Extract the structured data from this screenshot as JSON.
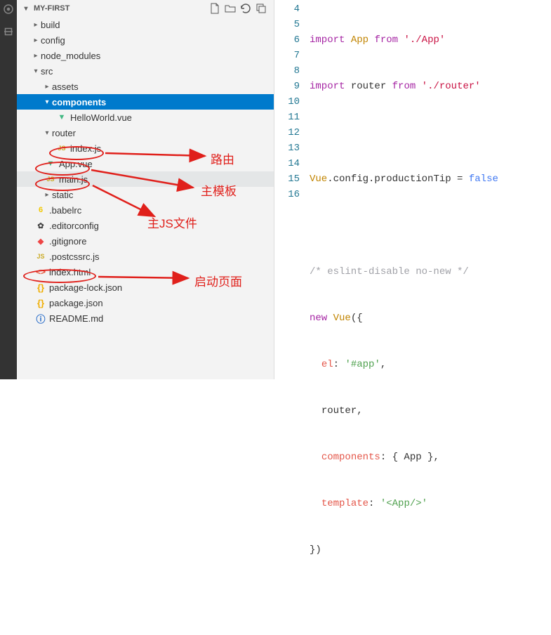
{
  "sidebar": {
    "project_label": "MY-FIRST",
    "items": {
      "build": "build",
      "config": "config",
      "node_modules": "node_modules",
      "src": "src",
      "assets": "assets",
      "components": "components",
      "helloworld": "HelloWorld.vue",
      "router": "router",
      "index_js": "index.js",
      "app_vue": "App.vue",
      "main_js": "main.js",
      "static": "static",
      "babelrc": ".babelrc",
      "editorconfig": ".editorconfig",
      "gitignore": ".gitignore",
      "postcssrc": ".postcssrc.js",
      "index_html": "index.html",
      "package_lock": "package-lock.json",
      "package": "package.json",
      "readme": "README.md"
    }
  },
  "code": {
    "l4_import": "import",
    "l4_app": "App",
    "l4_from": "from",
    "l4_path": "'./App'",
    "l5_import": "import",
    "l5_router": "router",
    "l5_from": "from",
    "l5_path": "'./router'",
    "l7_vue": "Vue",
    "l7_chain": ".config.productionTip = ",
    "l7_false": "false",
    "l8": "",
    "l9_cmt": "/* eslint-disable no-new */",
    "l10_new": "new",
    "l10_vue": "Vue",
    "l10_open": "({",
    "l11_el": "el",
    "l11_val": "'#app'",
    "l12_router": "router,",
    "l13_comp": "components",
    "l13_rest": ": { App },",
    "l14_tmpl": "template",
    "l14_val": "'<App/>'",
    "l15_close": "})"
  },
  "lines": {
    "l4": "4",
    "l5": "5",
    "l6": "6",
    "l7": "7",
    "l8": "8",
    "l9": "9",
    "l10": "10",
    "l11": "11",
    "l12": "12",
    "l13": "13",
    "l14": "14",
    "l15": "15",
    "l16": "16"
  },
  "annotations": {
    "router": "路由",
    "template": "主模板",
    "main_js": "主JS文件",
    "entry": "启动页面"
  }
}
